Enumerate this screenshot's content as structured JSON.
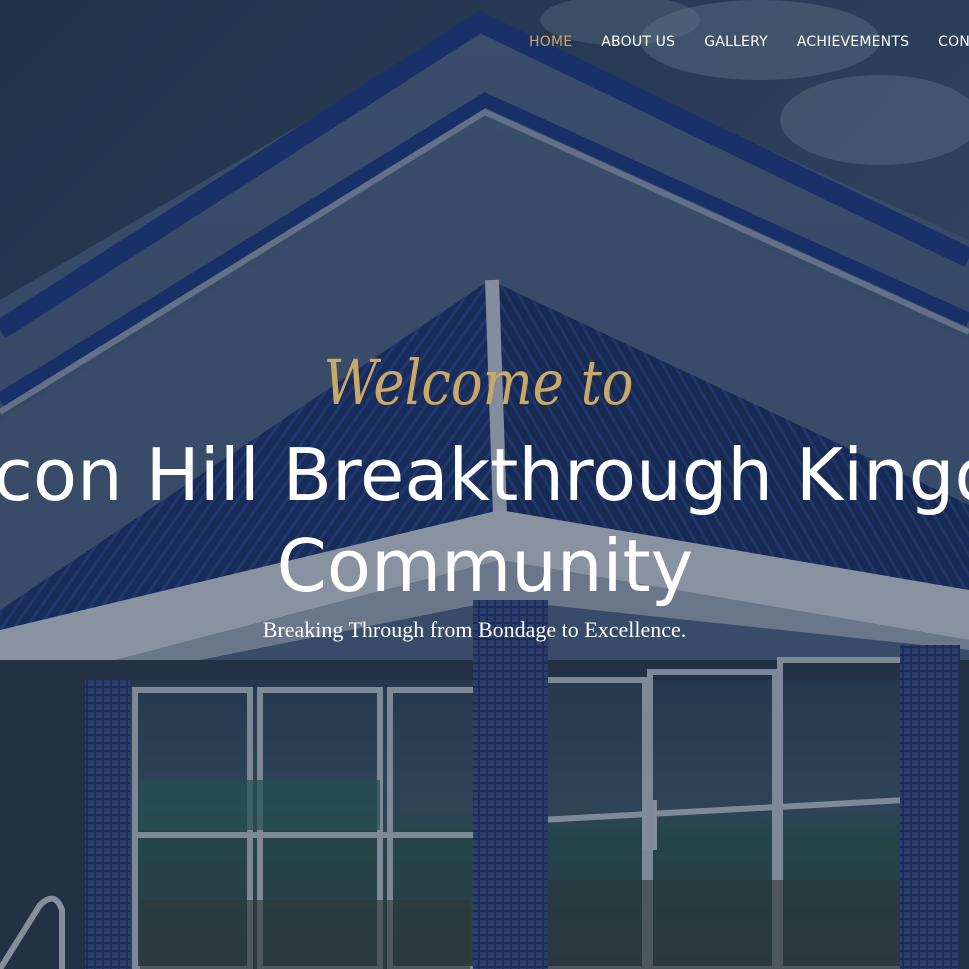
{
  "nav": {
    "items": [
      {
        "label": "HOME",
        "active": true
      },
      {
        "label": "ABOUT US",
        "active": false
      },
      {
        "label": "GALLERY",
        "active": false
      },
      {
        "label": "ACHIEVEMENTS",
        "active": false
      },
      {
        "label": "CONTACT",
        "active": false
      }
    ]
  },
  "hero": {
    "welcome": "Welcome to",
    "title_line1": "Beacon Hill Breakthrough Kingdom",
    "title_line2": "Community",
    "tagline": "Breaking Through from Bondage to Excellence."
  },
  "colors": {
    "accent": "#c9a86a",
    "text": "#ffffff",
    "overlay": "#1d2b44"
  }
}
